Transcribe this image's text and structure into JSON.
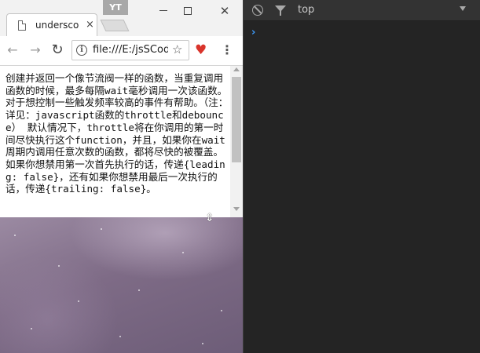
{
  "window": {
    "profile_badge": "YT",
    "minimize_icon": "minimize-icon",
    "maximize_icon": "maximize-icon",
    "close_icon": "close-icon"
  },
  "tab": {
    "title": "underscore",
    "close_glyph": "×"
  },
  "toolbar": {
    "back_glyph": "←",
    "forward_glyph": "→",
    "reload_glyph": "↻",
    "info_glyph": "i",
    "url": "file:///E:/jsSCode",
    "star_glyph": "☆",
    "extension_glyph": "♥",
    "menu_glyph": "⋮"
  },
  "page": {
    "text": "创建并返回一个像节流阀一样的函数，当重复调用函数的时候，最多每隔wait毫秒调用一次该函数。对于想控制一些触发频率较高的事件有帮助。（注：详见：javascript函数的throttle和debounce） 默认情况下，throttle将在你调用的第一时间尽快执行这个function，并且，如果你在wait周期内调用任意次数的函数，都将尽快的被覆盖。如果你想禁用第一次首先执行的话，传递{leading: false}，还有如果你想禁用最后一次执行的话，传递{trailing: false}。"
  },
  "devtools": {
    "context": "top",
    "prompt": "›",
    "colors": {
      "background": "#242424",
      "prompt": "#3d9dff",
      "text": "#c8c8c8"
    }
  },
  "icons": [
    "doc-icon",
    "back-arrow-icon",
    "forward-arrow-icon",
    "reload-icon",
    "info-icon",
    "star-icon",
    "heart-extension-icon",
    "kebab-menu-icon",
    "clear-console-icon",
    "filter-icon",
    "dropdown-arrow-icon",
    "resize-cursor-icon"
  ]
}
